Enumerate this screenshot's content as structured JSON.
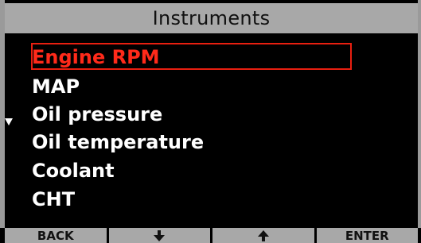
{
  "header": {
    "title": "Instruments"
  },
  "list": {
    "items": [
      {
        "label": "Engine RPM",
        "selected": true
      },
      {
        "label": "MAP",
        "selected": false
      },
      {
        "label": "Oil pressure",
        "selected": false
      },
      {
        "label": "Oil temperature",
        "selected": false
      },
      {
        "label": "Coolant",
        "selected": false
      },
      {
        "label": "CHT",
        "selected": false
      }
    ],
    "scroll_indicator_icon": "triangle-down-icon"
  },
  "softkeys": {
    "back_label": "BACK",
    "down_icon": "arrow-down-icon",
    "up_icon": "arrow-up-icon",
    "enter_label": "ENTER"
  },
  "colors": {
    "selected_text": "#ff2a1a",
    "selection_border": "#e81f10",
    "bar_background": "#a8a8a8",
    "screen_background": "#000000"
  }
}
